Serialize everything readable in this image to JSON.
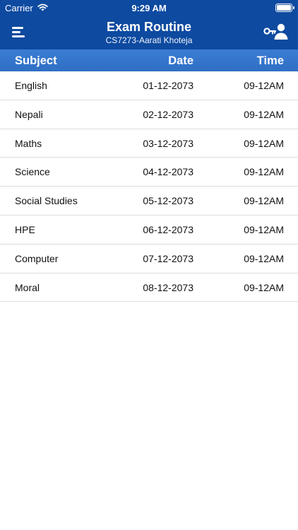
{
  "status_bar": {
    "carrier": "Carrier",
    "time": "9:29 AM"
  },
  "nav": {
    "title": "Exam Routine",
    "subtitle": "CS7273-Aarati Khoteja",
    "menu_icon": "hamburger-icon",
    "right_icon": "user-key-icon"
  },
  "table": {
    "headers": {
      "subject": "Subject",
      "date": "Date",
      "time": "Time"
    },
    "rows": [
      {
        "subject": "English",
        "date": "01-12-2073",
        "time": "09-12AM"
      },
      {
        "subject": "Nepali",
        "date": "02-12-2073",
        "time": "09-12AM"
      },
      {
        "subject": "Maths",
        "date": "03-12-2073",
        "time": "09-12AM"
      },
      {
        "subject": "Science",
        "date": "04-12-2073",
        "time": "09-12AM"
      },
      {
        "subject": "Social Studies",
        "date": "05-12-2073",
        "time": "09-12AM"
      },
      {
        "subject": "HPE",
        "date": "06-12-2073",
        "time": "09-12AM"
      },
      {
        "subject": "Computer",
        "date": "07-12-2073",
        "time": "09-12AM"
      },
      {
        "subject": "Moral",
        "date": "08-12-2073",
        "time": "09-12AM"
      }
    ]
  },
  "colors": {
    "nav_bg": "#0d4aa0",
    "header_bg": "#3a7dd3"
  }
}
